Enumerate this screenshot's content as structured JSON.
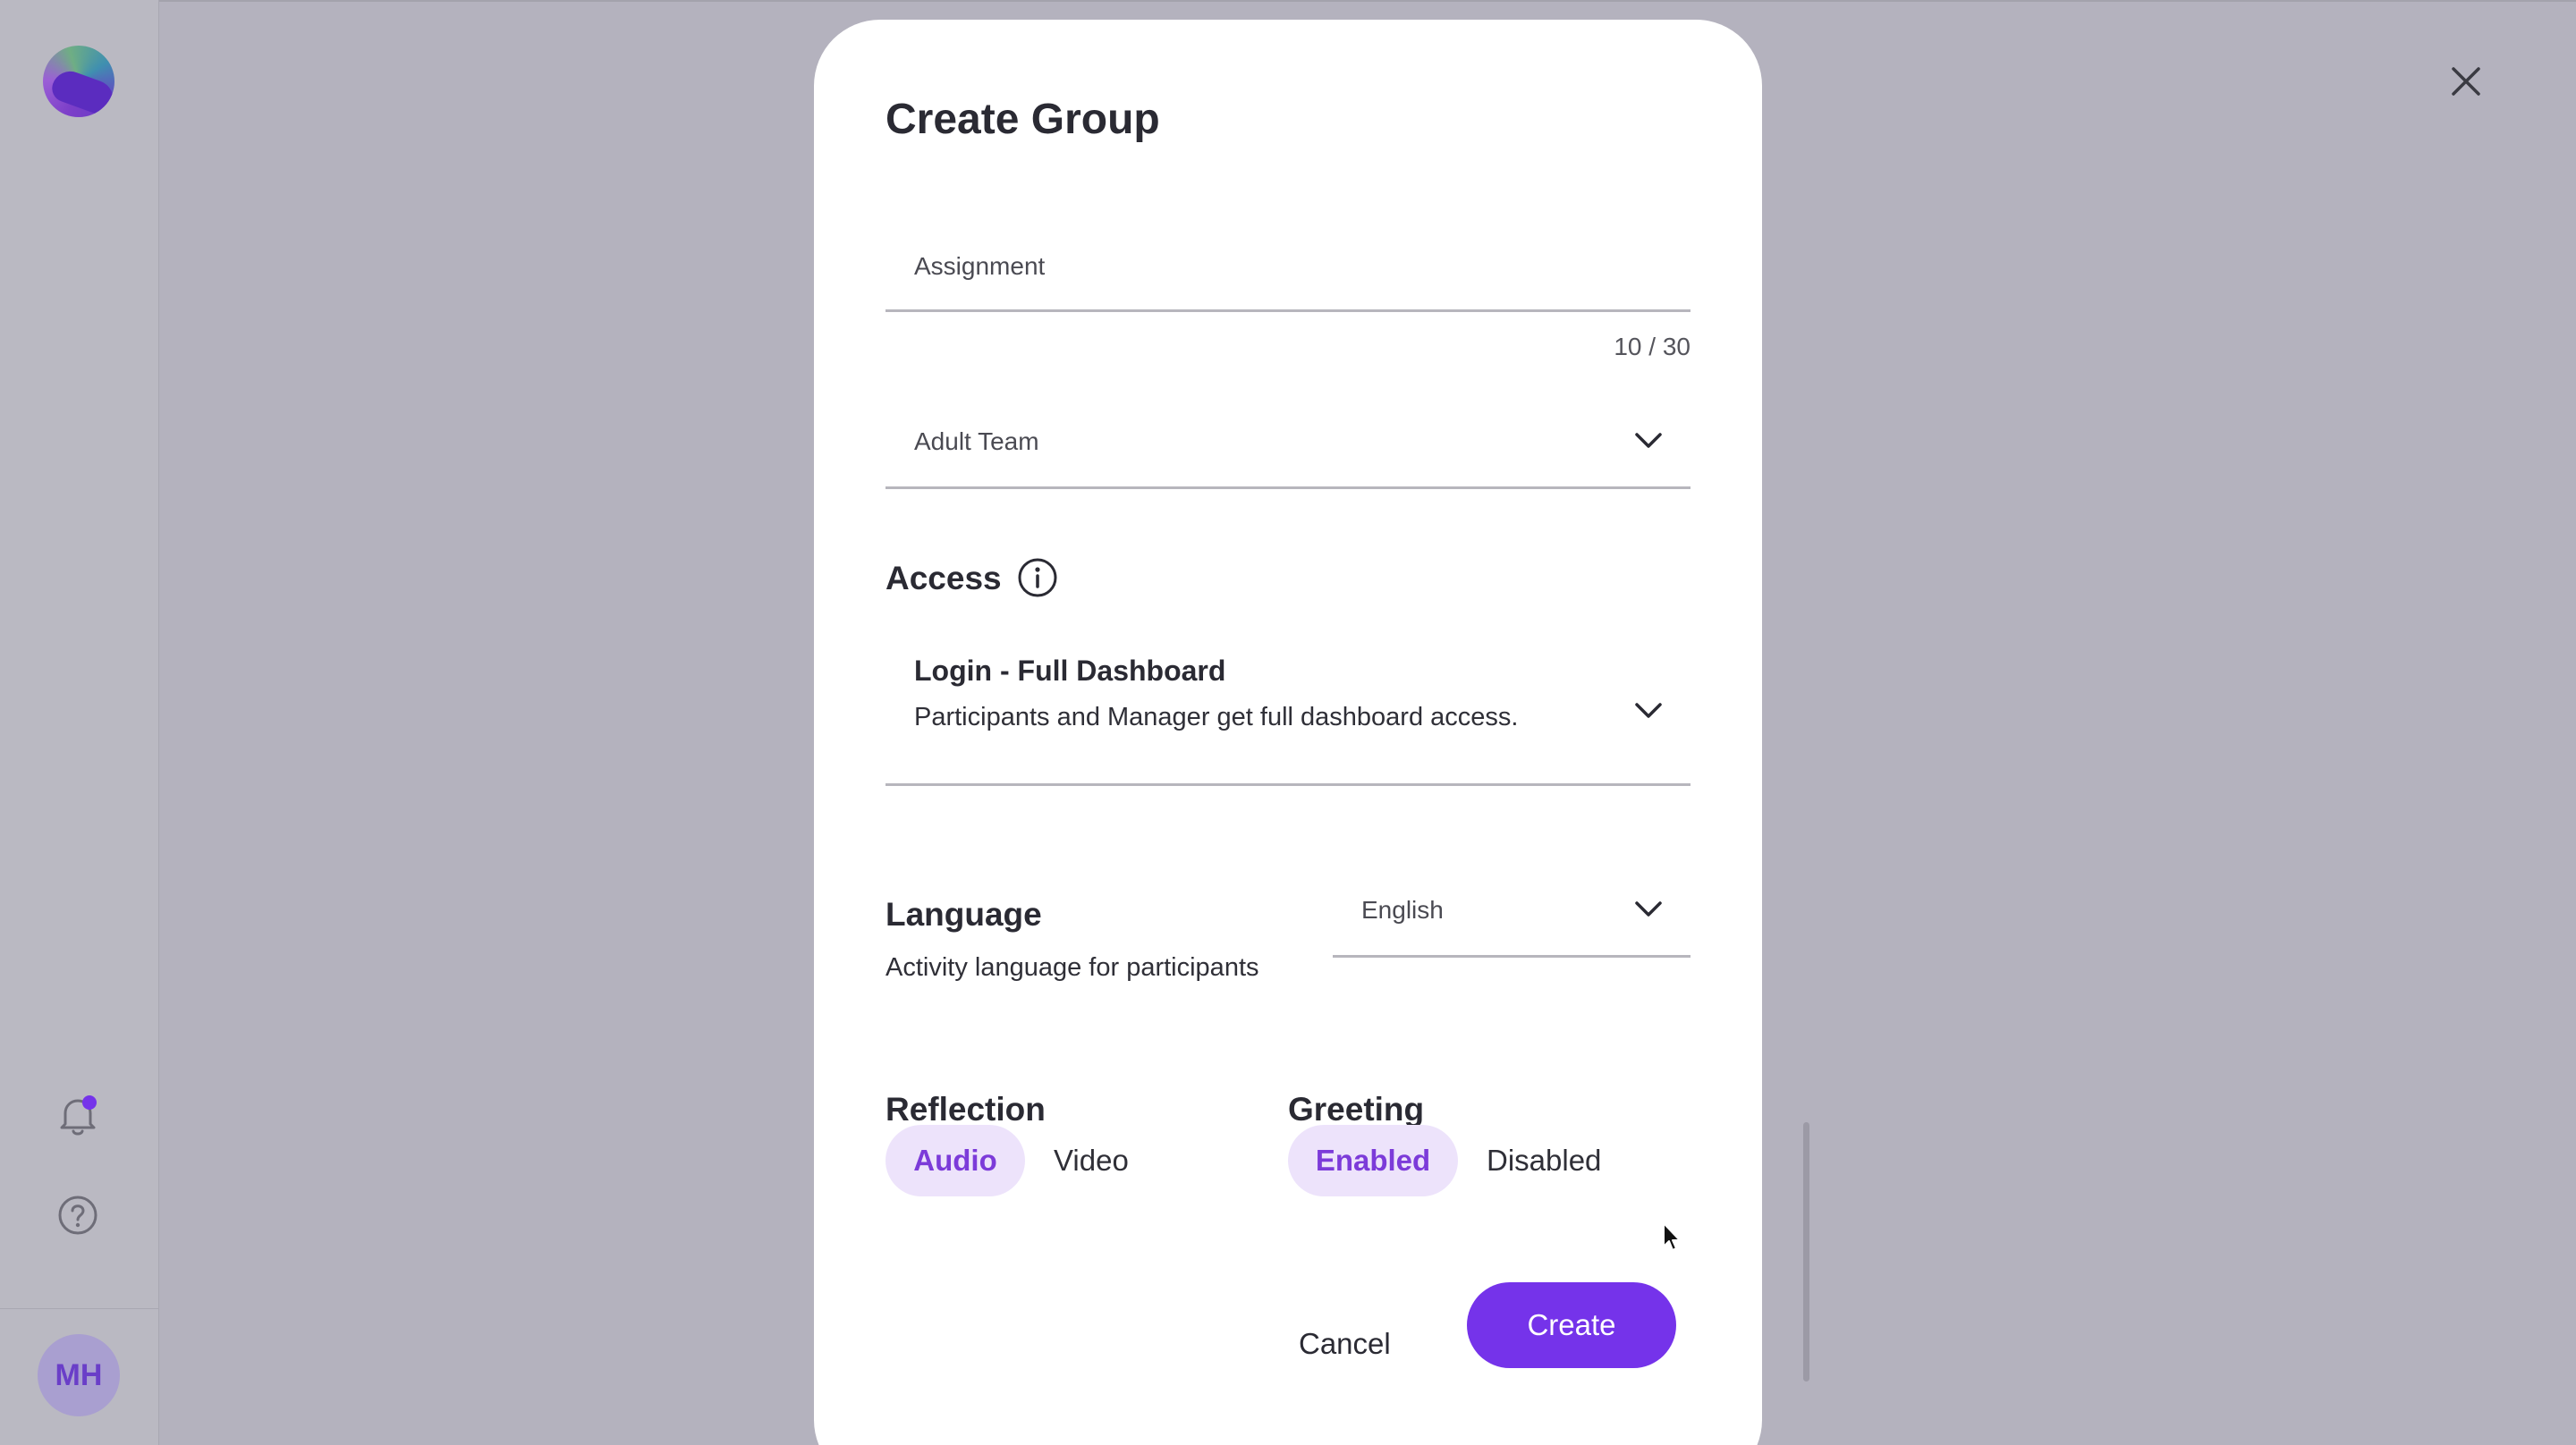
{
  "sidebar": {
    "logo": "app-logo",
    "bell_icon": "bell-icon",
    "help_icon": "help-icon",
    "avatar_initials": "MH",
    "notification_dot_color": "#7533ea"
  },
  "dialog": {
    "title": "Create Group",
    "name_field": {
      "value": "Assignment",
      "counter": "10 / 30"
    },
    "team_select": {
      "value": "Adult Team"
    },
    "access": {
      "label": "Access",
      "option_title": "Login - Full Dashboard",
      "option_description": "Participants and Manager get full dashboard access."
    },
    "language": {
      "label": "Language",
      "description": "Activity language for participants",
      "value": "English"
    },
    "reflection": {
      "label": "Reflection",
      "options": [
        "Audio",
        "Video"
      ],
      "selected": "Audio"
    },
    "greeting": {
      "label": "Greeting",
      "options": [
        "Enabled",
        "Disabled"
      ],
      "selected": "Enabled"
    },
    "cancel_label": "Cancel",
    "create_label": "Create"
  },
  "colors": {
    "accent": "#7533ea",
    "pill_bg": "#ede3fb",
    "pill_text": "#7c3bd9",
    "overlay": "#b4b2be"
  }
}
